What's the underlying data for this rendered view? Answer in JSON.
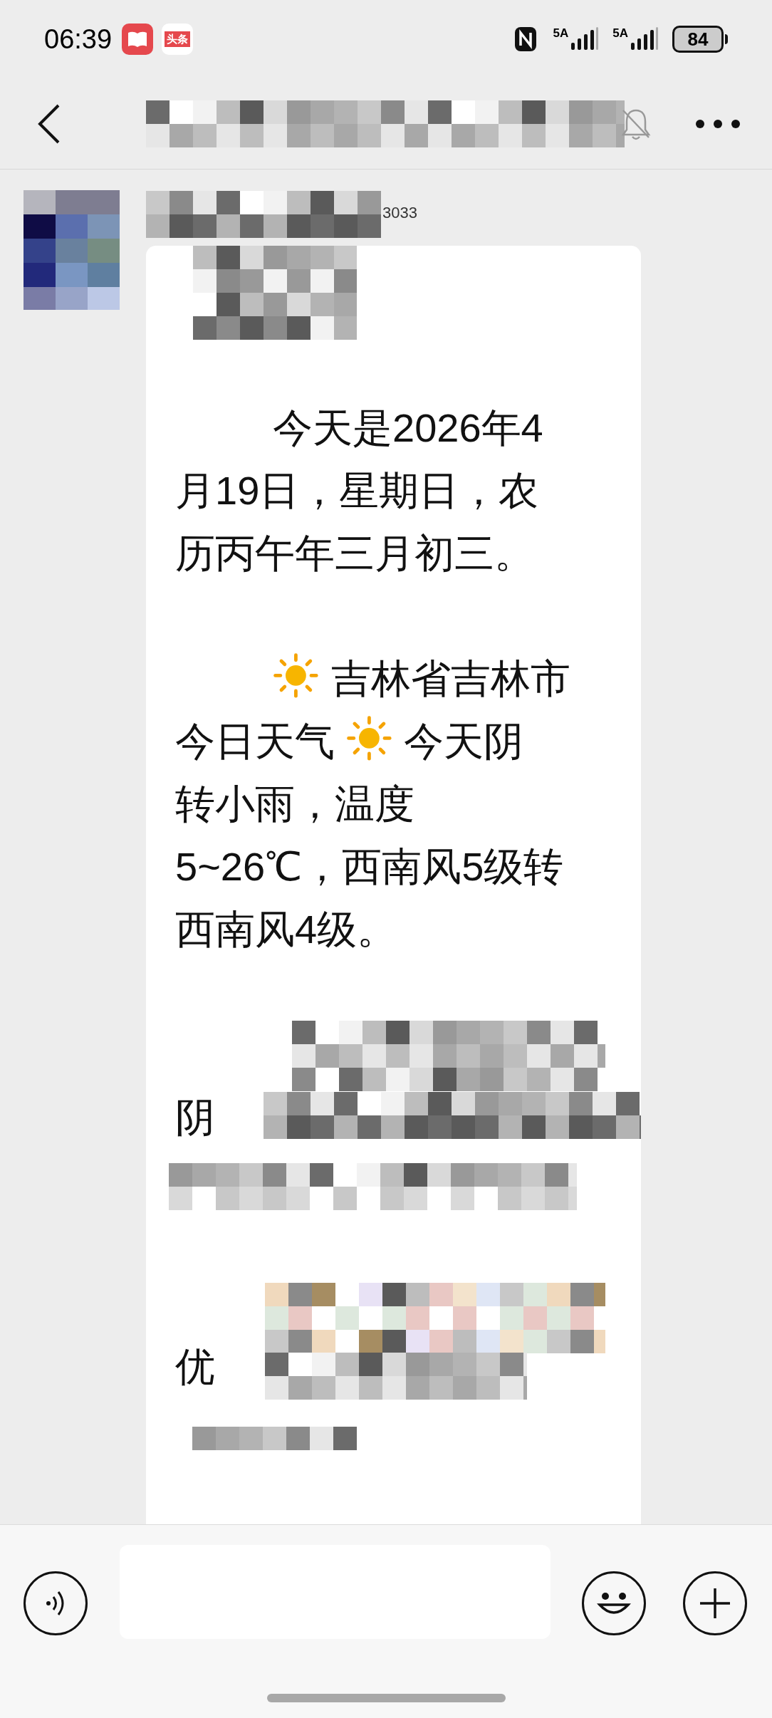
{
  "status_bar": {
    "time": "06:39",
    "news_app_label": "头条",
    "network_labels": [
      "5A",
      "5A"
    ],
    "battery": "84"
  },
  "chat": {
    "sender_suffix": "3033",
    "paragraphs": [
      {
        "segments": [
          {
            "kind": "text",
            "text": "今天是2026年4"
          },
          {
            "kind": "break"
          },
          {
            "kind": "text",
            "text": "月19日，星期日，农"
          },
          {
            "kind": "break"
          },
          {
            "kind": "text",
            "text": "历丙午年三月初三。"
          }
        ]
      },
      {
        "segments": [
          {
            "kind": "sun"
          },
          {
            "kind": "text",
            "text": " 吉林省吉林市"
          },
          {
            "kind": "break"
          },
          {
            "kind": "text",
            "text": "今日天气 "
          },
          {
            "kind": "sun"
          },
          {
            "kind": "text",
            "text": " 今天阴"
          },
          {
            "kind": "break"
          },
          {
            "kind": "text",
            "text": "转小雨，温度"
          },
          {
            "kind": "break"
          },
          {
            "kind": "text",
            "text": "5~26℃，西南风5级转"
          },
          {
            "kind": "break"
          },
          {
            "kind": "text",
            "text": "西南风4级。"
          }
        ]
      }
    ],
    "redacted_fragments": [
      "阴",
      "优"
    ]
  }
}
